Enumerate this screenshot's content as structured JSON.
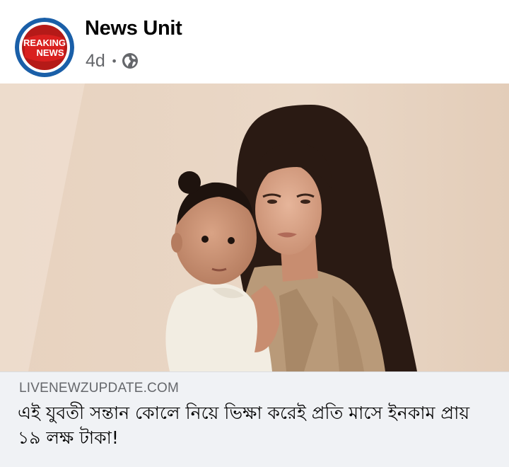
{
  "post": {
    "page_name": "News Unit",
    "time": "4d",
    "separator": "•",
    "privacy_icon": "globe-icon",
    "avatar": {
      "line1": "REAKING",
      "line2": "NEWS",
      "colors": {
        "ring": "#1a5fa8",
        "inner": "#ffffff",
        "badge": "#d9201f"
      }
    }
  },
  "link_preview": {
    "domain": "LIVENEWZUPDATE.COM",
    "title": "এই যুবতী সন্তান কোলে নিয়ে ভিক্ষা করেই প্রতি মাসে ইনকাম প্রায় ১৯ লক্ষ টাকা!"
  },
  "colors": {
    "page_name": "#050505",
    "meta": "#65676b",
    "link_box_bg": "#f0f2f5",
    "photo_backdrop": "#e9d5c3"
  }
}
